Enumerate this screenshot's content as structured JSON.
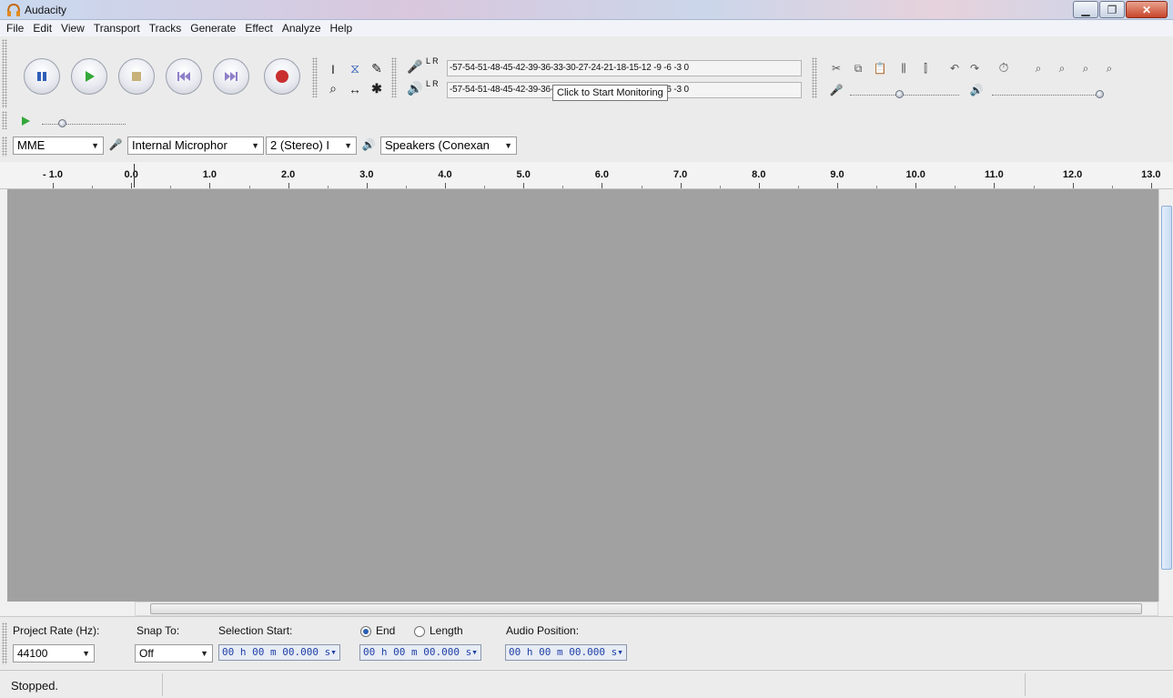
{
  "window": {
    "title": "Audacity"
  },
  "menu": [
    "File",
    "Edit",
    "View",
    "Transport",
    "Tracks",
    "Generate",
    "Effect",
    "Analyze",
    "Help"
  ],
  "meters": {
    "record_scale": "-57-54-51-48-45-42-39-36-33-30-27-24-21-18-15-12 -9  -6  -3  0",
    "playback_scale": "-57-54-51-48-45-42-39-36-33-30-27-24-21-18-15-12 -9  -6  -3  0",
    "record_scale_visible_right": "18-15-12 -9  -6  -3  0",
    "tooltip": "Click to Start Monitoring",
    "lr_top": "L R",
    "lr_bottom": "L R"
  },
  "device": {
    "host": "MME",
    "input_device": "Internal Microphor",
    "channels": "2 (Stereo) I",
    "output_device": "Speakers (Conexan"
  },
  "ruler": {
    "labels": [
      "- 1.0",
      "0.0",
      "1.0",
      "2.0",
      "3.0",
      "4.0",
      "5.0",
      "6.0",
      "7.0",
      "8.0",
      "9.0",
      "10.0",
      "11.0",
      "12.0",
      "13.0"
    ]
  },
  "selection_bar": {
    "project_rate_label": "Project Rate (Hz):",
    "project_rate_value": "44100",
    "snap_to_label": "Snap To:",
    "snap_to_value": "Off",
    "selection_start_label": "Selection Start:",
    "end_label": "End",
    "length_label": "Length",
    "audio_position_label": "Audio Position:",
    "selection_start_time": "00 h 00 m 00.000 s",
    "selection_end_time": "00 h 00 m 00.000 s",
    "audio_position_time": "00 h 00 m 00.000 s"
  },
  "status": {
    "text": "Stopped."
  },
  "colors": {
    "track_bg": "#a1a1a1",
    "record_red": "#c92f2f",
    "play_green": "#35a83a",
    "pause_blue": "#2f5fb8",
    "time_text": "#1f3fa6"
  }
}
